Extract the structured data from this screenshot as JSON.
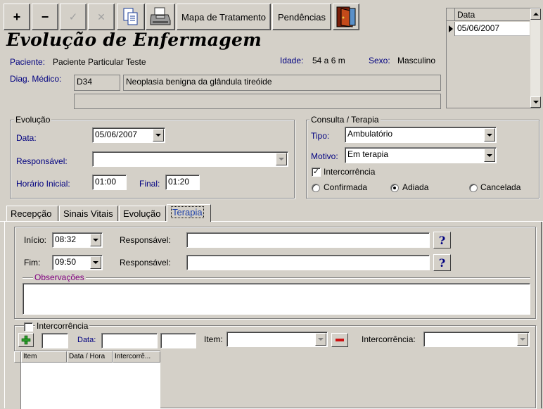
{
  "toolbar": {
    "add_label": "+",
    "remove_label": "−",
    "confirm_label": "✓",
    "cancel_label": "✕",
    "mapa_label": "Mapa de Tratamento",
    "pendencias_label": "Pendências"
  },
  "title": "Evolução de Enfermagem",
  "patient": {
    "paciente_label": "Paciente:",
    "paciente_value": "Paciente Particular Teste",
    "idade_label": "Idade:",
    "idade_value": "54 a 6 m",
    "sexo_label": "Sexo:",
    "sexo_value": "Masculino",
    "diag_label": "Diag. Médico:",
    "diag_code": "D34",
    "diag_desc": "Neoplasia benigna da glândula tireóide",
    "diag_extra": ""
  },
  "date_grid": {
    "header": "Data",
    "rows": [
      "05/06/2007"
    ]
  },
  "evolucao": {
    "group_title": "Evolução",
    "data_label": "Data:",
    "data_value": "05/06/2007",
    "responsavel_label": "Responsável:",
    "responsavel_value": "",
    "horario_inicial_label": "Horário Inicial:",
    "horario_inicial_value": "01:00",
    "final_label": "Final:",
    "final_value": "01:20"
  },
  "consulta": {
    "group_title": "Consulta / Terapia",
    "tipo_label": "Tipo:",
    "tipo_value": "Ambulatório",
    "motivo_label": "Motivo:",
    "motivo_value": "Em terapia",
    "intercorrencia_label": "Intercorrência",
    "intercorrencia_checked": true,
    "radio_confirmada": "Confirmada",
    "radio_adiada": "Adiada",
    "radio_cancelada": "Cancelada",
    "selected": "Adiada"
  },
  "tabs": [
    "Recepção",
    "Sinais Vitais",
    "Evolução",
    "Terapia"
  ],
  "active_tab": "Terapia",
  "terapia": {
    "inicio_label": "Início:",
    "inicio_value": "08:32",
    "fim_label": "Fim:",
    "fim_value": "09:50",
    "responsavel_label": "Responsável:",
    "responsavel1_value": "",
    "responsavel2_value": "",
    "help_label": "?",
    "observacoes_label": "Observações",
    "observacoes_value": "",
    "intercorrencia_label": "Intercorrência",
    "intercorrencia_checked": false,
    "data_label": "Data:",
    "item_label": "Item:",
    "intercorrencia_field_label": "Intercorrência:",
    "grid_headers": [
      "Item",
      "Data / Hora",
      "Intercorrê..."
    ]
  },
  "colors": {
    "background": "#d4d0c8",
    "label_blue": "#000080",
    "label_purple": "#800080",
    "add_green": "#2a9a2a",
    "remove_red": "#cc1111"
  }
}
